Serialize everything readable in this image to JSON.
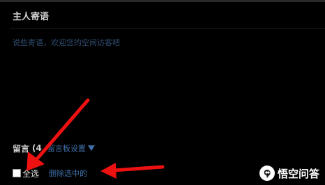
{
  "owner_message": {
    "title": "主人寄语",
    "placeholder": "说些寄语，欢迎您的空间访客吧"
  },
  "message_board": {
    "label": "留言",
    "count": "(4",
    "settings_link": "留言板设置",
    "settings_caret_icon": "caret-down-icon"
  },
  "batch_actions": {
    "select_all": "全选",
    "delete_selected": "删除选中的"
  },
  "watermark": {
    "icon": "wukong-logo-icon",
    "text": "悟空问答"
  },
  "colors": {
    "background": "#000000",
    "link": "#3f6fa8",
    "hint_text": "#2f4d72",
    "arrow": "#ee1111"
  }
}
